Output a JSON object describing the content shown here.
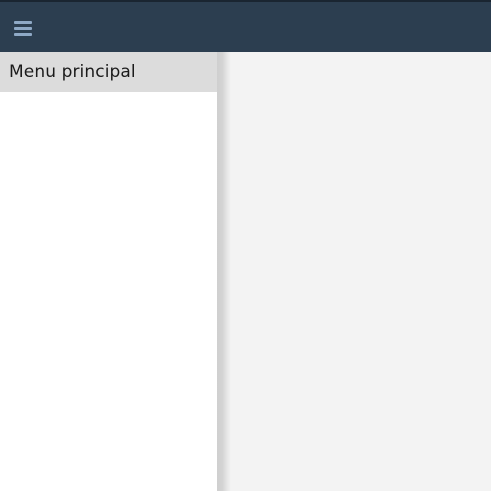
{
  "topbar": {
    "menu_icon": "hamburger-icon",
    "background": "#2c3e50",
    "icon_color": "#8fa9c6"
  },
  "sidebar": {
    "title": "Menu principal",
    "header_background": "#dcdcdc"
  },
  "main": {
    "background": "#f3f3f3"
  }
}
